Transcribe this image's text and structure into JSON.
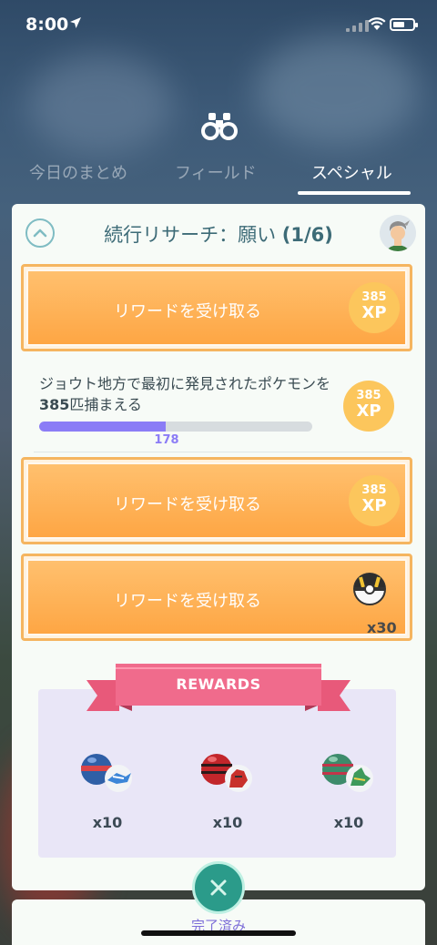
{
  "status_bar": {
    "time": "8:00"
  },
  "tabs": [
    {
      "label": "今日のまとめ",
      "active": false
    },
    {
      "label": "フィールド",
      "active": false
    },
    {
      "label": "スペシャル",
      "active": true
    }
  ],
  "research": {
    "title": "続行リサーチ：願い",
    "step": "(1/6)"
  },
  "tasks": [
    {
      "type": "claim",
      "label": "リワードを受け取る",
      "reward_amount": "385",
      "reward_unit": "XP"
    },
    {
      "type": "progress",
      "text_before": "ジョウト地方で最初に発見されたポケモンを",
      "text_number": "385",
      "text_after": "匹捕まえる",
      "progress_value": "178",
      "progress_fraction": 0.462,
      "reward_amount": "385",
      "reward_unit": "XP"
    },
    {
      "type": "claim",
      "label": "リワードを受け取る",
      "reward_amount": "385",
      "reward_unit": "XP"
    },
    {
      "type": "claim",
      "label": "リワードを受け取る",
      "reward_item": "ultra-ball-icon",
      "reward_count": "x30"
    }
  ],
  "rewards": {
    "header": "REWARDS",
    "items": [
      {
        "icon": "great-ball-pokemon-icon",
        "count": "x10"
      },
      {
        "icon": "poke-ball-pokemon-icon",
        "count": "x10"
      },
      {
        "icon": "green-ball-pokemon-icon",
        "count": "x10"
      }
    ]
  },
  "footer": {
    "done_label": "完了済み"
  },
  "colors": {
    "orange": "#fea644",
    "xp_coin": "#fcc65c",
    "progress": "#8b7cf6",
    "ribbon": "#f06b8c",
    "teal": "#2b9b8a"
  }
}
